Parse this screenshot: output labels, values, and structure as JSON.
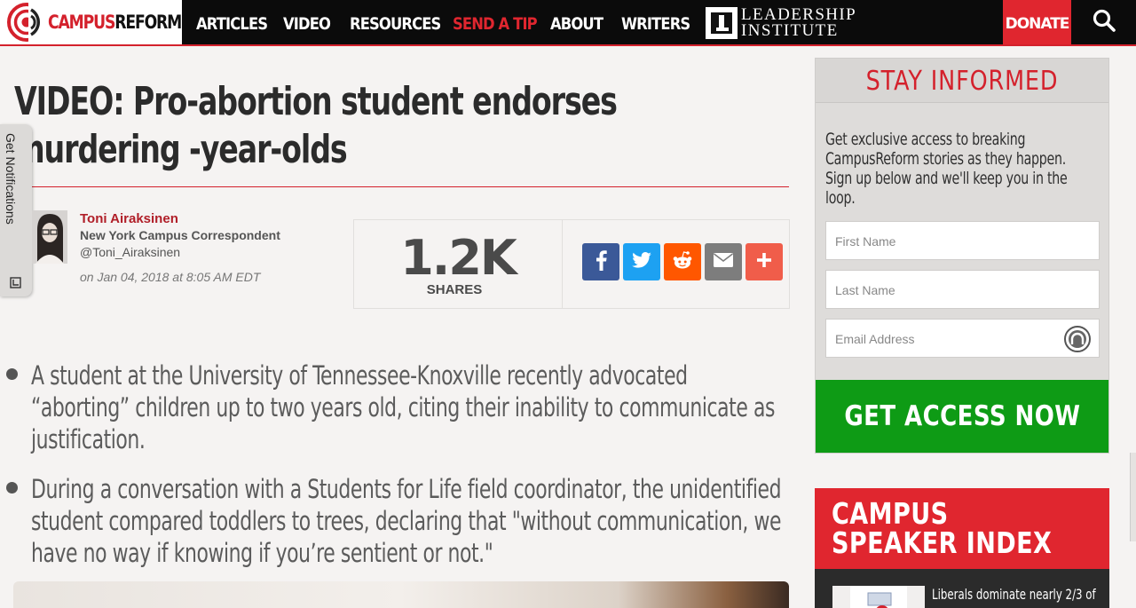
{
  "brand": {
    "logo_campus": "CAMPUS",
    "logo_reform": "REFORM"
  },
  "nav": {
    "items": [
      {
        "label": "ARTICLES"
      },
      {
        "label": "VIDEO"
      },
      {
        "label": "RESOURCES"
      },
      {
        "label": "SEND A TIP"
      },
      {
        "label": "ABOUT"
      },
      {
        "label": "WRITERS"
      }
    ],
    "partner_line1": "LEADERSHIP",
    "partner_line2": "INSTITUTE",
    "donate_label": "DONATE",
    "search_icon": "search-icon"
  },
  "colors": {
    "brand_red": "#d4212c",
    "cta_green": "#0e9b15",
    "facebook": "#3b5998",
    "twitter": "#1da1f2",
    "reddit": "#ff5700",
    "email": "#7d7d7d",
    "more": "#f05d4a"
  },
  "notifications_tab": {
    "label": "Get Notifications"
  },
  "article": {
    "title": "VIDEO: Pro-abortion student endorses murdering -year-olds",
    "author": {
      "name": "Toni Airaksinen",
      "role": "New York Campus Correspondent",
      "handle": "@Toni_Airaksinen",
      "date": "on Jan 04, 2018 at 8:05 AM EDT"
    },
    "shares": {
      "count": "1.2K",
      "label": "SHARES",
      "buttons": [
        "facebook-icon",
        "twitter-icon",
        "reddit-icon",
        "email-icon",
        "plus-icon"
      ]
    },
    "bullets": [
      "A student at the University of Tennessee-Knoxville recently advocated “aborting” children up to two years old, citing their inability to communicate as justification.",
      "During a conversation with a Students for Life field coordinator, the unidentified student compared toddlers to trees, declaring that \"without communication, we have no way if knowing if you’re sentient or not.\""
    ]
  },
  "sidebar": {
    "stay_informed": {
      "title": "STAY INFORMED",
      "description": "Get exclusive access to breaking CampusReform stories as they happen. Sign up below and we'll keep you in the loop.",
      "fields": {
        "first_name_placeholder": "First Name",
        "last_name_placeholder": "Last Name",
        "email_placeholder": "Email Address"
      },
      "cta_label": "GET ACCESS NOW"
    },
    "speaker_index": {
      "title": "CAMPUS SPEAKER INDEX",
      "first_item": "Liberals dominate nearly 2/3 of"
    }
  }
}
